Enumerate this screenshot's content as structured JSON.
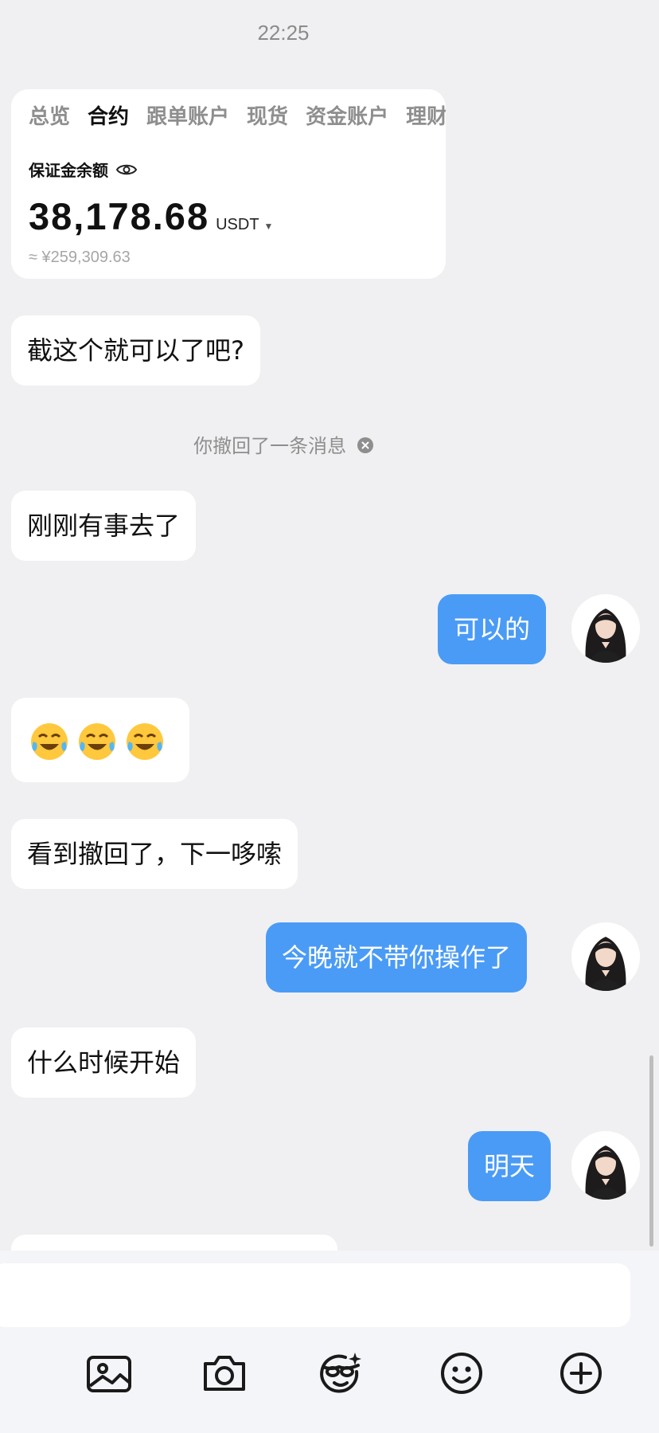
{
  "status_bar": {
    "time": "22:25"
  },
  "account_card": {
    "tabs": [
      {
        "label": "总览",
        "active": false
      },
      {
        "label": "合约",
        "active": true
      },
      {
        "label": "跟单账户",
        "active": false
      },
      {
        "label": "现货",
        "active": false
      },
      {
        "label": "资金账户",
        "active": false
      },
      {
        "label": "理财",
        "active": false
      }
    ],
    "balance_label": "保证金余额",
    "amount": "38,178.68",
    "currency": "USDT",
    "approx_cny": "≈ ¥259,309.63"
  },
  "messages": {
    "m1": "截这个就可以了吧?",
    "recall_notice": "你撤回了一条消息",
    "m2": "刚刚有事去了",
    "m3": "可以的",
    "m4_emoji_count": 3,
    "m5": "看到撤回了，下一哆嗦",
    "m6": "今晚就不带你操作了",
    "m7": "什么时候开始",
    "m8": "明天"
  },
  "toolbar": {
    "items": [
      "image-icon",
      "camera-icon",
      "sticker-icon",
      "smiley-icon",
      "plus-icon"
    ]
  },
  "colors": {
    "background": "#f0f0f2",
    "sent_bubble": "#4a9bf6",
    "received_bubble": "#ffffff"
  }
}
